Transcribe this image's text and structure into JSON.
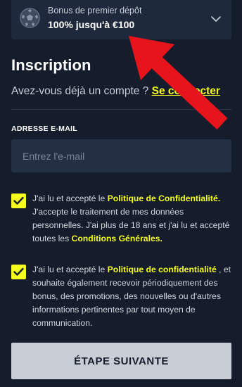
{
  "bonus": {
    "subtitle": "Bonus de premier dépôt",
    "amount": "100% jusqu'à €100",
    "icon": "soccer-ball-icon"
  },
  "signup": {
    "title": "Inscription",
    "have_account": "Avez-vous déjà un compte ? ",
    "login_link": "Se connecter"
  },
  "email": {
    "label": "ADRESSE E-MAIL",
    "placeholder": "Entrez l'e-mail",
    "value": ""
  },
  "consent1": {
    "checked": true,
    "t1": "J'ai lu et accepté le ",
    "link1": "Politique de Confidentialité.",
    "t2": " J'accepte le traitement de mes données personnelles. J'ai plus de 18 ans et j'ai lu et accepté toutes les ",
    "link2": "Conditions Générales."
  },
  "consent2": {
    "checked": true,
    "t1": "J'ai lu et accepté le  ",
    "link1": "Politique de confidentialité",
    "t2": " , et souhaite également recevoir périodiquement des bonus, des promotions, des nouvelles ou d'autres informations pertinentes par tout moyen de communication."
  },
  "submit": {
    "label": "ÉTAPE SUIVANTE"
  },
  "colors": {
    "background": "#151d2d",
    "accent": "#f5ff1e",
    "card": "#1e2a3c",
    "input": "#233044",
    "button": "#c9cdd6",
    "annotation_arrow": "#e8141b"
  }
}
